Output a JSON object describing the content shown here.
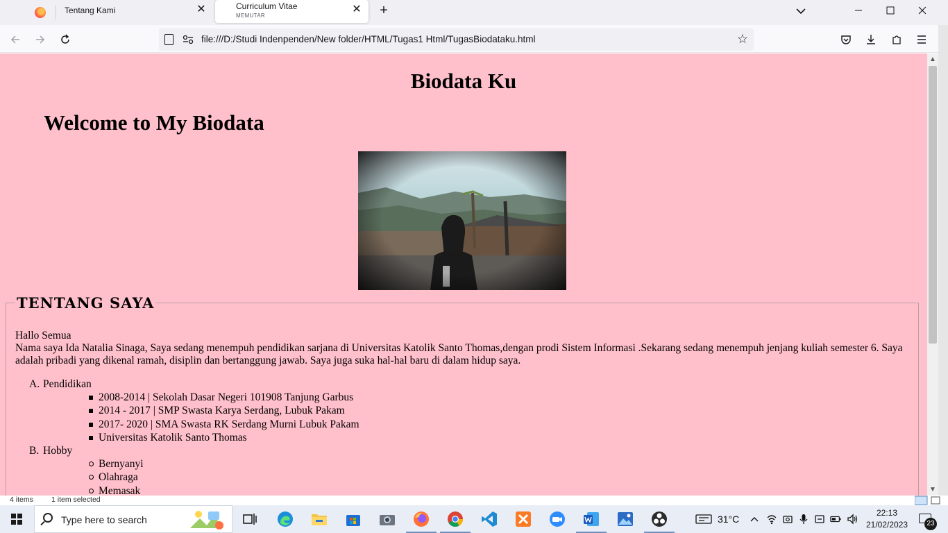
{
  "browser": {
    "tabs": [
      {
        "title": "Tentang Kami"
      },
      {
        "title": "Curriculum Vitae",
        "subtitle": "MEMUTAR"
      }
    ],
    "url": "file:///D:/Studi Indenpenden/New folder/HTML/Tugas1 Html/TugasBiodataku.html",
    "accent": "#15141a"
  },
  "page": {
    "background": "#ffc0cb",
    "title": "Biodata Ku",
    "welcome": "Welcome to My Biodata",
    "about": {
      "legend": "TENTANG SAYA",
      "greeting": "Hallo Semua",
      "intro": "Nama saya Ida Natalia Sinaga, Saya sedang menempuh pendidikan sarjana di Universitas Katolik Santo Thomas,dengan prodi Sistem Informasi .Sekarang sedang menempuh jenjang kuliah semester 6. Saya adalah pribadi yang dikenal ramah, disiplin dan bertanggung jawab. Saya juga suka hal-hal baru di dalam hidup saya.",
      "sections": [
        {
          "marker": "A.",
          "label": "Pendidikan",
          "items": [
            "2008-2014 | Sekolah Dasar Negeri 101908 Tanjung Garbus",
            "2014 - 2017 | SMP Swasta Karya Serdang, Lubuk Pakam",
            "2017- 2020 | SMA Swasta RK Serdang Murni Lubuk Pakam",
            "Universitas Katolik Santo Thomas"
          ]
        },
        {
          "marker": "B.",
          "label": "Hobby",
          "items": [
            "Bernyanyi",
            "Olahraga",
            "Memasak"
          ]
        }
      ]
    }
  },
  "explorer_status": {
    "items": "4 items",
    "selected": "1 item selected"
  },
  "taskbar": {
    "search_placeholder": "Type here to search",
    "temperature": "31°C",
    "time": "22:13",
    "date": "21/02/2023",
    "notification_count": "23"
  }
}
